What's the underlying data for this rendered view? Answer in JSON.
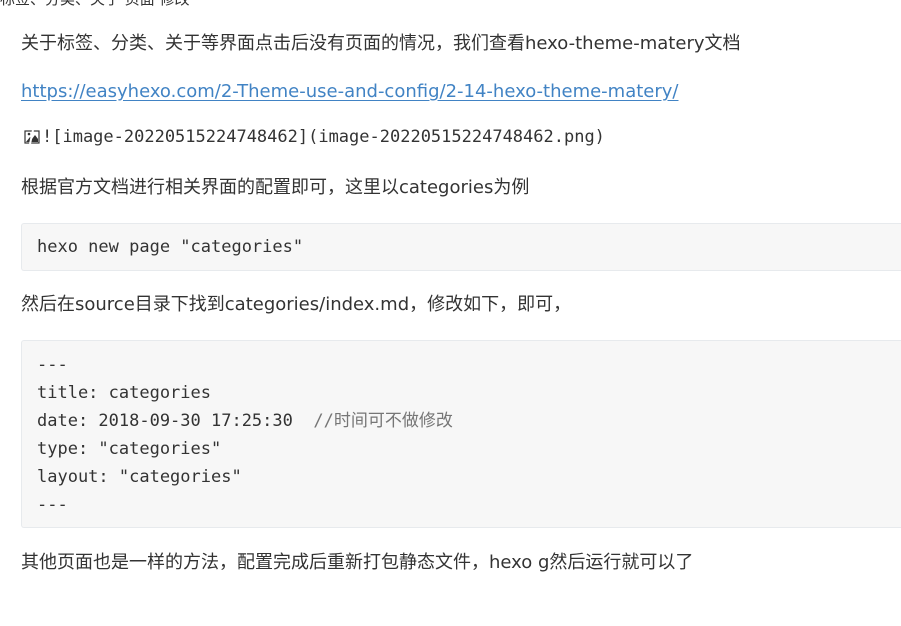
{
  "top_cut_text": "标签、分类、关于 页面 修改",
  "intro_text": "关于标签、分类、关于等界面点击后没有页面的情况，我们查看hexo-theme-matery文档",
  "doc_link": "https://easyhexo.com/2-Theme-use-and-config/2-14-hexo-theme-matery/",
  "image_placeholder": "![image-20220515224748462](image-20220515224748462.png)",
  "config_text": "根据官方文档进行相关界面的配置即可，这里以categories为例",
  "code1": "hexo new page \"categories\"",
  "then_text": "然后在source目录下找到categories/index.md，修改如下，即可，",
  "code2": {
    "line1": "---",
    "line2": "title: categories",
    "line3": "date: 2018-09-30 17:25:30  ",
    "line3_comment": "//时间可不做修改",
    "line4": "type: \"categories\"",
    "line5": "layout: \"categories\"",
    "line6": "---"
  },
  "outro_text": "其他页面也是一样的方法，配置完成后重新打包静态文件，hexo g然后运行就可以了"
}
